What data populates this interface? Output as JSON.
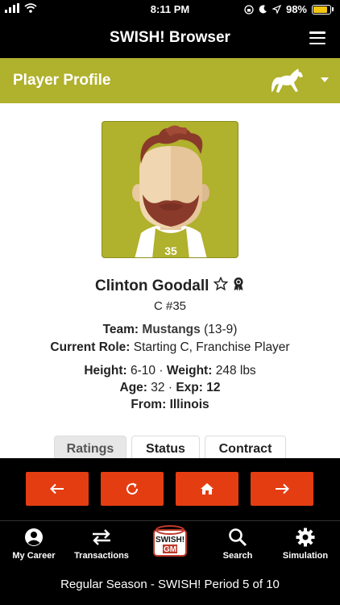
{
  "status_bar": {
    "time": "8:11 PM",
    "battery": "98%"
  },
  "app": {
    "title": "SWISH! Browser"
  },
  "profile_bar": {
    "title": "Player Profile"
  },
  "player": {
    "name": "Clinton Goodall",
    "position_number": "C #35",
    "jersey_number": "35",
    "team_label": "Team:",
    "team_name": "Mustangs",
    "team_record": "(13-9)",
    "role_label": "Current Role:",
    "role_value": "Starting C, Franchise Player",
    "height_label": "Height:",
    "height_value": "6-10",
    "weight_label": "Weight:",
    "weight_value": "248 lbs",
    "age_label": "Age:",
    "age_value": "32",
    "exp_label": "Exp:",
    "exp_value": "12",
    "from_label": "From:",
    "from_value": "Illinois"
  },
  "tabs": [
    {
      "label": "Ratings",
      "active": true
    },
    {
      "label": "Status",
      "active": false
    },
    {
      "label": "Contract",
      "active": false
    }
  ],
  "nav": {
    "items": [
      {
        "label": "My Career",
        "icon": "account-circle-icon"
      },
      {
        "label": "Transactions",
        "icon": "swap-arrows-icon"
      },
      {
        "label": "",
        "icon": "swish-gm-logo"
      },
      {
        "label": "Search",
        "icon": "search-icon"
      },
      {
        "label": "Simulation",
        "icon": "gear-icon"
      }
    ],
    "logo_text_top": "SWISH!",
    "logo_text_bottom": "GM"
  },
  "footer": {
    "text": "Regular Season - SWISH! Period 5 of 10"
  },
  "colors": {
    "accent_olive": "#b0b12c",
    "action_red": "#e43d12",
    "black": "#000000"
  }
}
